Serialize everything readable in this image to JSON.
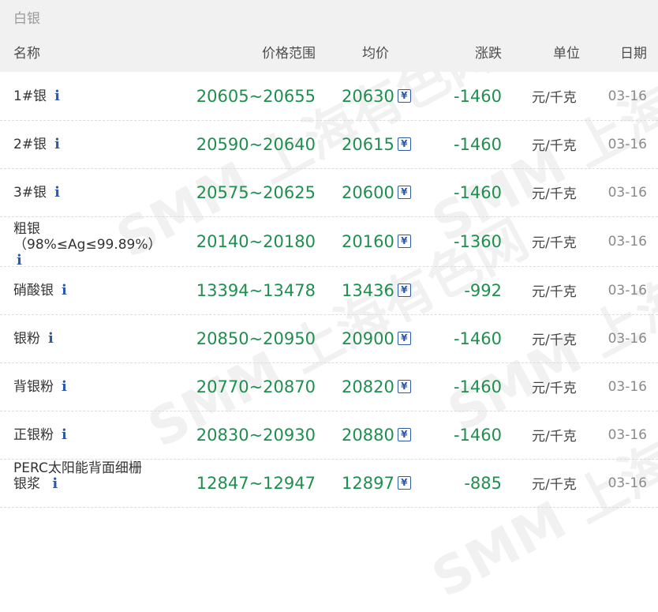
{
  "section": {
    "title": "白银"
  },
  "header": {
    "name": "名称",
    "range": "价格范围",
    "avg": "均价",
    "change": "涨跌",
    "unit": "单位",
    "date": "日期"
  },
  "rows": [
    {
      "name": "1#银",
      "range": "20605~20655",
      "avg": "20630",
      "change": "-1460",
      "unit": "元/千克",
      "date": "03-16"
    },
    {
      "name": "2#银",
      "range": "20590~20640",
      "avg": "20615",
      "change": "-1460",
      "unit": "元/千克",
      "date": "03-16"
    },
    {
      "name": "3#银",
      "range": "20575~20625",
      "avg": "20600",
      "change": "-1460",
      "unit": "元/千克",
      "date": "03-16"
    },
    {
      "name": "粗银",
      "name_line2": "（98%≤Ag≤99.89%）",
      "range": "20140~20180",
      "avg": "20160",
      "change": "-1360",
      "unit": "元/千克",
      "date": "03-16"
    },
    {
      "name": "硝酸银",
      "range": "13394~13478",
      "avg": "13436",
      "change": "-992",
      "unit": "元/千克",
      "date": "03-16"
    },
    {
      "name": "银粉",
      "range": "20850~20950",
      "avg": "20900",
      "change": "-1460",
      "unit": "元/千克",
      "date": "03-16"
    },
    {
      "name": "背银粉",
      "range": "20770~20870",
      "avg": "20820",
      "change": "-1460",
      "unit": "元/千克",
      "date": "03-16"
    },
    {
      "name": "正银粉",
      "range": "20830~20930",
      "avg": "20880",
      "change": "-1460",
      "unit": "元/千克",
      "date": "03-16"
    },
    {
      "name": "PERC太阳能背面细栅",
      "name_line2": "银浆",
      "range": "12847~12947",
      "avg": "12897",
      "change": "-885",
      "unit": "元/千克",
      "date": "03-16"
    }
  ],
  "icons": {
    "info": "info-icon",
    "avg_detail": "yen-calendar-icon"
  },
  "colors": {
    "price_green": "#1e8f4e",
    "icon_blue": "#2b5aa8",
    "header_bg": "#f1f1f1"
  },
  "watermark": {
    "text_en": "SMM",
    "text_cn": "上海有色网"
  }
}
